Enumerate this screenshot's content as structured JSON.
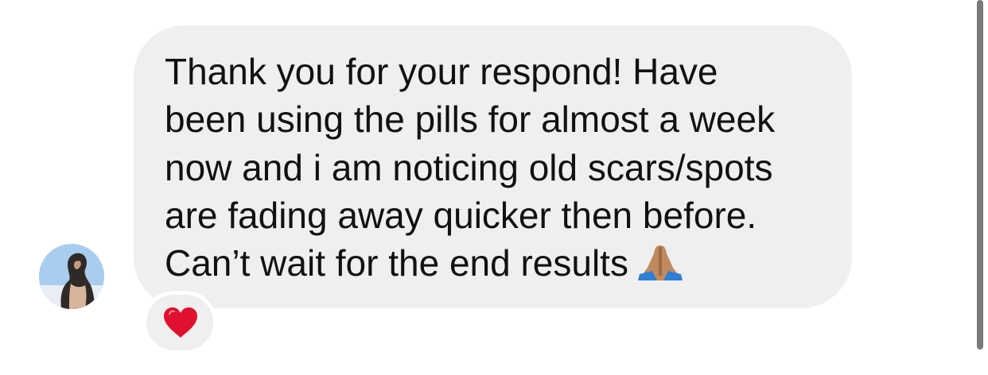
{
  "message": {
    "lines": [
      "Thank you for your respond! Have",
      "been using the pills for almost a week",
      "now and i am noticing old scars/spots",
      "are fading away quicker then before.",
      "Can’t wait for the end results"
    ],
    "emoji_icon": "folded-hands-icon",
    "reaction_icon": "red-heart-icon"
  },
  "colors": {
    "bubble": "#efefef",
    "text": "#111111",
    "heart": "#e0102f"
  }
}
